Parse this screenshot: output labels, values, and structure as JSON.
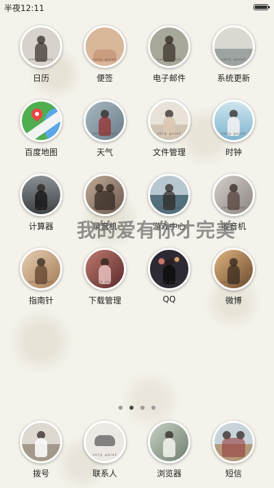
{
  "status": {
    "time": "半夜12:11"
  },
  "overlay_text": "我的爱有你才完美",
  "photo_tag": "very quiet",
  "apps": [
    {
      "label": "日历",
      "icon": "photo-girl-bokeh-icon",
      "bg": "#d7d2cb"
    },
    {
      "label": "便签",
      "icon": "photo-hands-icon",
      "bg": "#d8b79a"
    },
    {
      "label": "电子邮件",
      "icon": "photo-girl-field-icon",
      "bg": "#a8a89a"
    },
    {
      "label": "系统更新",
      "icon": "photo-sea-icon",
      "bg": "#c5c5bd"
    },
    {
      "label": "百度地图",
      "icon": "map-icon",
      "bg": "#4fae4f"
    },
    {
      "label": "天气",
      "icon": "photo-girl-tree-icon",
      "bg": "#8fa3b4"
    },
    {
      "label": "文件管理",
      "icon": "photo-girl-beach-icon",
      "bg": "#e3dcd2"
    },
    {
      "label": "时钟",
      "icon": "photo-girl-water-icon",
      "bg": "#9cc8dc"
    },
    {
      "label": "计算器",
      "icon": "photo-girl-seated-icon",
      "bg": "#5d6468"
    },
    {
      "label": "录音机",
      "icon": "photo-friends-icon",
      "bg": "#9a8676"
    },
    {
      "label": "游戏中心",
      "icon": "photo-girl-cliff-icon",
      "bg": "#7f9aa8"
    },
    {
      "label": "收音机",
      "icon": "photo-girl-hair-icon",
      "bg": "#b0aba9"
    },
    {
      "label": "指南针",
      "icon": "photo-girl-light-icon",
      "bg": "#c9a88a"
    },
    {
      "label": "下载管理",
      "icon": "photo-girl-pink-icon",
      "bg": "#8d4a48"
    },
    {
      "label": "QQ",
      "icon": "photo-girl-lights-icon",
      "bg": "#3b3440"
    },
    {
      "label": "微博",
      "icon": "photo-girl-sunset-icon",
      "bg": "#b88a5c"
    }
  ],
  "page_indicator": {
    "count": 4,
    "active": 2
  },
  "dock": [
    {
      "label": "拨号",
      "icon": "photo-girl-dress-icon",
      "bg": "#c9c4bd"
    },
    {
      "label": "联系人",
      "icon": "photo-hands-rings-icon",
      "bg": "#e6e3df"
    },
    {
      "label": "浏览器",
      "icon": "photo-girl-sofa-icon",
      "bg": "#a9b7a6"
    },
    {
      "label": "短信",
      "icon": "photo-kids-beach-icon",
      "bg": "#b2a28e"
    }
  ]
}
